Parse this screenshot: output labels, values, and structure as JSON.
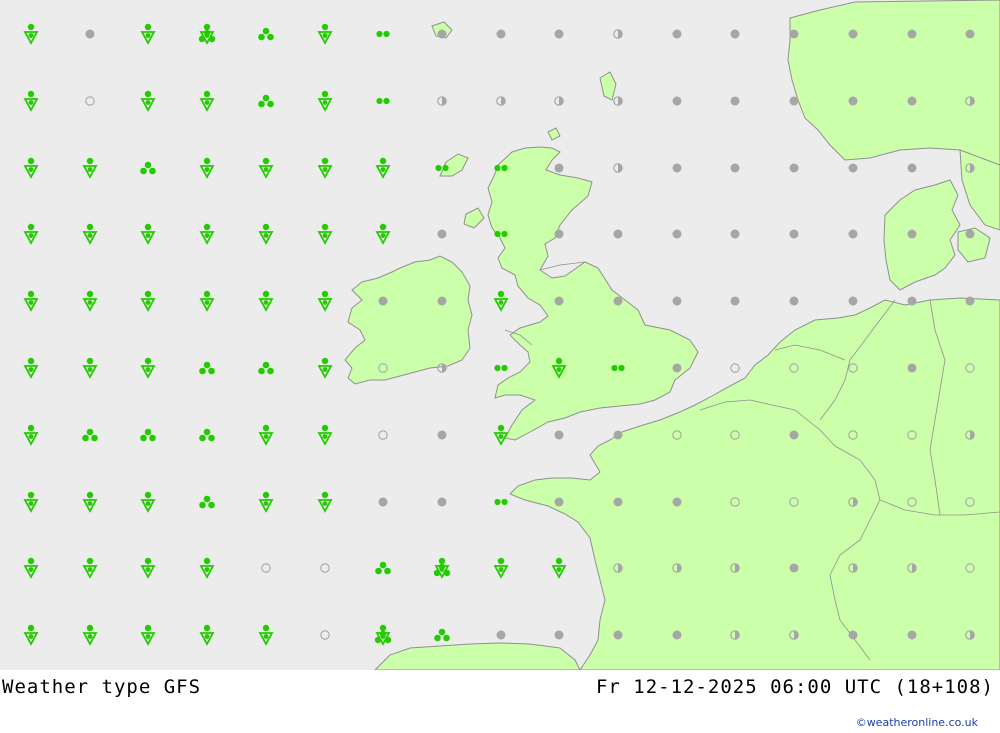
{
  "footer": {
    "title": "Weather type  GFS",
    "datetime": "Fr 12-12-2025 06:00 UTC (18+108)"
  },
  "credit": "©weatheronline.co.uk",
  "colors": {
    "sea": "#ececec",
    "land": "#ccffaa",
    "coast": "#909090",
    "precip": "#22cc00",
    "dry": "#a6a6a6"
  },
  "symbol_legend": {
    "snow-shower": "green triangle with dot (shower)",
    "rain-shower": "green dot above triangle",
    "heavy-rain": "three green dots",
    "rain": "two green dots",
    "overcast": "grey filled dot",
    "cloudy": "grey half-filled dot",
    "clear": "grey ring"
  },
  "grid": {
    "cols": 17,
    "rows": 10,
    "cells": [
      [
        "shower",
        "overcast",
        "shower",
        "heavy-showers",
        "heavy-rain",
        "shower",
        "rain",
        "overcast",
        "overcast",
        "overcast",
        "cloudy",
        "overcast",
        "overcast",
        "overcast",
        "overcast",
        "overcast",
        "overcast"
      ],
      [
        "shower",
        "clear",
        "shower",
        "shower",
        "heavy-rain",
        "shower",
        "rain",
        "cloudy",
        "cloudy",
        "cloudy",
        "cloudy",
        "overcast",
        "overcast",
        "overcast",
        "overcast",
        "overcast",
        "cloudy"
      ],
      [
        "shower",
        "shower",
        "heavy-rain",
        "shower",
        "shower",
        "shower",
        "shower",
        "rain",
        "rain",
        "overcast",
        "cloudy",
        "overcast",
        "overcast",
        "overcast",
        "overcast",
        "overcast",
        "cloudy"
      ],
      [
        "shower",
        "shower",
        "shower",
        "shower",
        "shower",
        "shower",
        "shower",
        "overcast",
        "rain",
        "overcast",
        "overcast",
        "overcast",
        "overcast",
        "overcast",
        "overcast",
        "overcast",
        "overcast"
      ],
      [
        "shower",
        "shower",
        "shower",
        "shower",
        "shower",
        "shower",
        "overcast",
        "overcast",
        "shower",
        "overcast",
        "overcast",
        "overcast",
        "overcast",
        "overcast",
        "overcast",
        "overcast",
        "overcast"
      ],
      [
        "shower",
        "shower",
        "shower",
        "heavy-rain",
        "heavy-rain",
        "shower",
        "clear",
        "cloudy",
        "rain",
        "shower",
        "rain",
        "overcast",
        "clear",
        "clear",
        "clear",
        "overcast",
        "clear"
      ],
      [
        "shower",
        "heavy-rain",
        "heavy-rain",
        "heavy-rain",
        "shower",
        "shower",
        "clear",
        "overcast",
        "shower",
        "overcast",
        "overcast",
        "clear",
        "clear",
        "overcast",
        "clear",
        "clear",
        "cloudy"
      ],
      [
        "shower",
        "shower",
        "shower",
        "heavy-rain",
        "shower",
        "shower",
        "overcast",
        "overcast",
        "rain",
        "overcast",
        "overcast",
        "overcast",
        "clear",
        "clear",
        "cloudy",
        "clear",
        "clear"
      ],
      [
        "shower",
        "shower",
        "shower",
        "shower",
        "clear",
        "clear",
        "heavy-rain",
        "heavy-showers",
        "shower",
        "shower",
        "cloudy",
        "cloudy",
        "cloudy",
        "overcast",
        "cloudy",
        "cloudy",
        "clear"
      ],
      [
        "shower",
        "shower",
        "shower",
        "shower",
        "shower",
        "clear",
        "heavy-showers",
        "heavy-rain",
        "overcast",
        "overcast",
        "overcast",
        "overcast",
        "cloudy",
        "cloudy",
        "overcast",
        "overcast",
        "cloudy"
      ]
    ]
  }
}
